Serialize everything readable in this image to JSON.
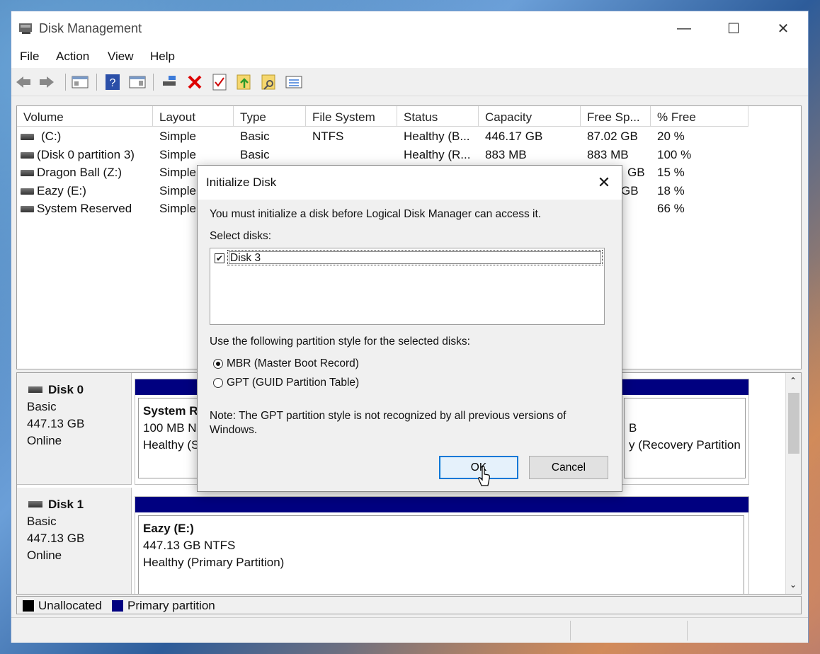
{
  "window": {
    "title": "Disk Management",
    "minimize": "—",
    "maximize": "☐",
    "close": "✕"
  },
  "menu": [
    "File",
    "Action",
    "View",
    "Help"
  ],
  "toolbar": {
    "icons": [
      "back-icon",
      "forward-icon",
      "console-tree-icon",
      "help-icon",
      "properties-pane-icon",
      "connect-disk-icon",
      "delete-icon",
      "check-icon",
      "up-folder-icon",
      "search-folder-icon",
      "list-icon"
    ]
  },
  "volume_table": {
    "columns": [
      "Volume",
      "Layout",
      "Type",
      "File System",
      "Status",
      "Capacity",
      "Free Sp...",
      "% Free"
    ],
    "rows": [
      {
        "volume": "(C:)",
        "layout": "Simple",
        "type": "Basic",
        "fs": "NTFS",
        "status": "Healthy (B...",
        "capacity": "446.17 GB",
        "free": "87.02 GB",
        "pct": "20 %"
      },
      {
        "volume": "(Disk 0 partition 3)",
        "layout": "Simple",
        "type": "Basic",
        "fs": "",
        "status": "Healthy (R...",
        "capacity": "883 MB",
        "free": "883 MB",
        "pct": "100 %"
      },
      {
        "volume": "Dragon Ball (Z:)",
        "layout": "Simple",
        "type": "",
        "fs": "",
        "status": "",
        "capacity": "",
        "free": "GB",
        "pct": "15 %"
      },
      {
        "volume": "Eazy (E:)",
        "layout": "Simple",
        "type": "",
        "fs": "",
        "status": "",
        "capacity": "",
        "free": "GB",
        "pct": "18 %"
      },
      {
        "volume": "System Reserved",
        "layout": "Simple",
        "type": "",
        "fs": "",
        "status": "",
        "capacity": "",
        "free": "",
        "pct": "66 %"
      }
    ]
  },
  "disks": [
    {
      "name": "Disk 0",
      "type": "Basic",
      "size": "447.13 GB",
      "state": "Online",
      "part_left": {
        "title": "System R",
        "line1": "100 MB N",
        "line2": "Healthy (S"
      },
      "part_right": {
        "line1": "B",
        "line2": "y (Recovery Partition"
      }
    },
    {
      "name": "Disk 1",
      "type": "Basic",
      "size": "447.13 GB",
      "state": "Online",
      "part": {
        "title": "Eazy  (E:)",
        "line1": "447.13 GB NTFS",
        "line2": "Healthy (Primary Partition)"
      }
    }
  ],
  "legend": {
    "unallocated": "Unallocated",
    "primary": "Primary partition",
    "unallocated_color": "#000000",
    "primary_color": "#000080"
  },
  "dialog": {
    "title": "Initialize Disk",
    "message": "You must initialize a disk before Logical Disk Manager can access it.",
    "select_label": "Select disks:",
    "disk_item": "Disk 3",
    "style_label": "Use the following partition style for the selected disks:",
    "mbr": "MBR (Master Boot Record)",
    "gpt": "GPT (GUID Partition Table)",
    "note_line1": "Note: The GPT partition style is not recognized by all previous versions of",
    "note_line2": "Windows.",
    "ok": "OK",
    "cancel": "Cancel",
    "close": "✕"
  }
}
